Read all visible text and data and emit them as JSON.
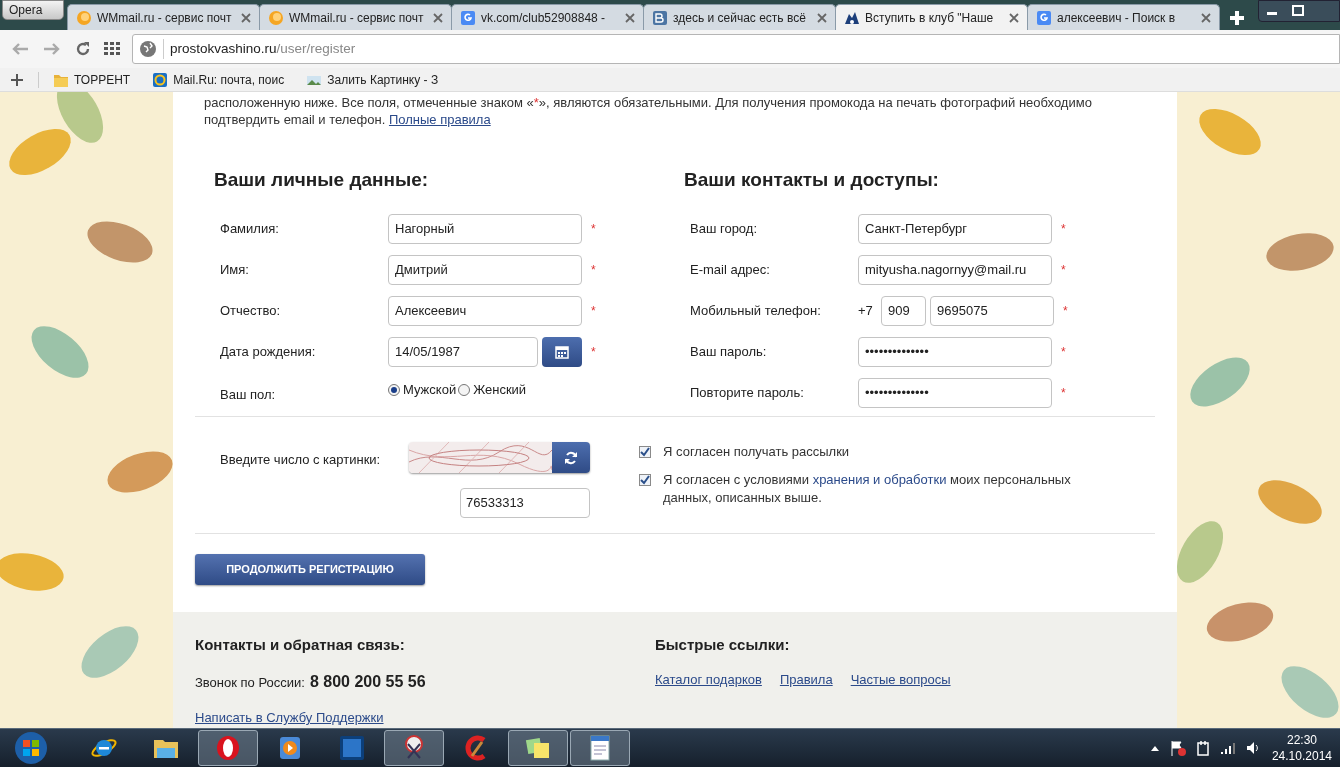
{
  "browser": {
    "menu_button": "Opera",
    "tabs": [
      {
        "title": "WMmail.ru - сервис почт",
        "kind": "orange",
        "selected": false
      },
      {
        "title": "WMmail.ru - сервис почт",
        "kind": "orange",
        "selected": false
      },
      {
        "title": "vk.com/club52908848 -",
        "kind": "google",
        "selected": false
      },
      {
        "title": "здесь и сейчас есть всё",
        "kind": "vk",
        "selected": false
      },
      {
        "title": "Вступить в клуб \"Наше",
        "kind": "club",
        "selected": true
      },
      {
        "title": "алексеевич - Поиск в",
        "kind": "google",
        "selected": false
      }
    ],
    "url_host": "prostokvashino.ru",
    "url_path": "/user/register",
    "bookmarks": [
      {
        "label": "ТОРРЕНТ",
        "kind": "folder"
      },
      {
        "label": "Mail.Ru: почта, поис",
        "kind": "mail"
      },
      {
        "label": "Залить Картинку - З"
      }
    ]
  },
  "intro": {
    "line": "расположенную ниже. Все поля, отмеченные знаком «",
    "star": "*",
    "rest": "», являются обязательными. Для получения промокода на печать фотографий необходимо подтвердить email и телефон.",
    "link": "Полные правила"
  },
  "personal": {
    "title": "Ваши личные данные:",
    "fields": [
      {
        "kind": "text",
        "label": "Фамилия:",
        "value": "Нагорный",
        "mark": "*"
      },
      {
        "kind": "text",
        "label": "Имя:",
        "value": "Дмитрий",
        "mark": "*"
      },
      {
        "kind": "text",
        "label": "Отчество:",
        "value": "Алексеевич",
        "mark": "*"
      },
      {
        "kind": "date",
        "label": "Дата рождения:",
        "value": "14/05/1987",
        "mark": "*"
      },
      {
        "kind": "radio",
        "label": "Ваш пол:",
        "options": [
          {
            "label": "Мужской",
            "selected": true
          },
          {
            "label": "Женский",
            "selected": false
          }
        ]
      }
    ]
  },
  "contacts": {
    "title": "Ваши контакты и доступы:",
    "fields": [
      {
        "kind": "text",
        "label": "Ваш город:",
        "value": "Санкт-Петербург",
        "mark": "*"
      },
      {
        "kind": "text",
        "label": "E-mail адрес:",
        "value": "mityusha.nagornyy@mail.ru",
        "mark": "*"
      },
      {
        "kind": "phone",
        "label": "Мобильный телефон:",
        "prefix": "+7",
        "code": "909",
        "value": "9695075",
        "mark": "*"
      },
      {
        "kind": "text",
        "label": "Ваш пароль:",
        "value": "••••••••••••••",
        "mark": "*"
      },
      {
        "kind": "text",
        "label": "Повторите пароль:",
        "value": "••••••••••••••",
        "mark": "*"
      }
    ]
  },
  "captcha": {
    "label": "Введите число с картинки:",
    "value": "76533313"
  },
  "agreements": [
    {
      "checked": true,
      "text": "Я согласен получать рассылки"
    },
    {
      "checked": true,
      "text": "Я согласен с условиями ",
      "link": "хранения и обработки",
      "after": " моих персональных данных, описанных выше."
    }
  ],
  "submit": "ПРОДОЛЖИТЬ РЕГИСТРАЦИЮ",
  "footer": {
    "contacts_title": "Контакты и обратная связь:",
    "phone_label": "Звонок по России:",
    "phone": "8 800 200 55 56",
    "support_link": "Написать в Службу Поддержки",
    "links_title": "Быстрые ссылки:",
    "links": [
      "Каталог подарков",
      "Правила",
      "Частые вопросы"
    ]
  },
  "taskbar": {
    "apps": [
      {
        "kind": "ie",
        "open": false
      },
      {
        "kind": "explorer",
        "open": false
      },
      {
        "kind": "opera",
        "open": true
      },
      {
        "kind": "media",
        "open": false
      },
      {
        "kind": "ps",
        "open": false
      },
      {
        "kind": "scissors",
        "open": true
      },
      {
        "kind": "cleaner",
        "open": false
      },
      {
        "kind": "notes",
        "open": true
      },
      {
        "kind": "wordpad",
        "open": true
      }
    ],
    "time": "22:30",
    "date": "24.10.2014"
  }
}
